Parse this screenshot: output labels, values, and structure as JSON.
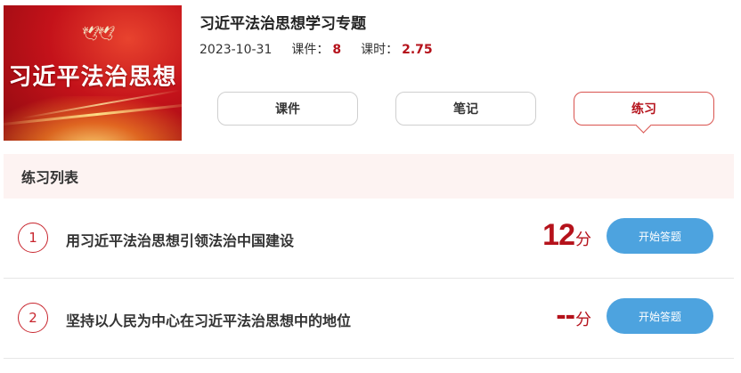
{
  "course": {
    "banner_title": "习近平法治思想",
    "title": "习近平法治思想学习专题",
    "date": "2023-10-31",
    "lessons_label": "课件：",
    "lessons_count": "8",
    "hours_label": "课时：",
    "hours_value": "2.75"
  },
  "tabs": [
    {
      "label": "课件",
      "active": false
    },
    {
      "label": "笔记",
      "active": false
    },
    {
      "label": "练习",
      "active": true
    }
  ],
  "list": {
    "header": "练习列表",
    "items": [
      {
        "index": "1",
        "title": "用习近平法治思想引领法治中国建设",
        "score": "12",
        "unit": "分",
        "button": "开始答题"
      },
      {
        "index": "2",
        "title": "坚持以人民为中心在习近平法治思想中的地位",
        "score": "--",
        "unit": "分",
        "button": "开始答题"
      }
    ]
  },
  "colors": {
    "accent_red": "#b5121b",
    "button_blue": "#4da3df",
    "header_bg": "#fdf3f2"
  }
}
